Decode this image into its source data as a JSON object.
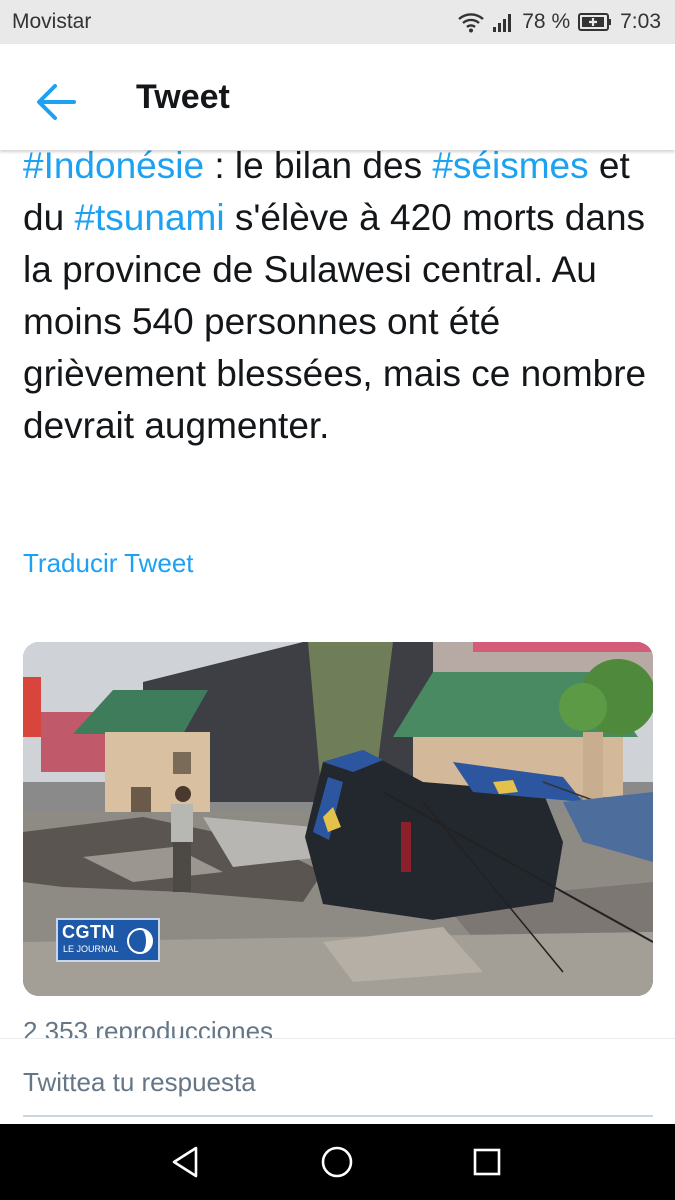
{
  "status_bar": {
    "carrier": "Movistar",
    "battery": "78 %",
    "time": "7:03"
  },
  "header": {
    "title": "Tweet"
  },
  "tweet": {
    "segments": [
      {
        "text": "#Indonésie",
        "hashtag": true
      },
      {
        "text": " : le bilan des ",
        "hashtag": false
      },
      {
        "text": "#séismes",
        "hashtag": true
      },
      {
        "text": " et du ",
        "hashtag": false
      },
      {
        "text": "#tsunami",
        "hashtag": true
      },
      {
        "text": " s'élève à 420 morts dans la province de Sulawesi central. Au moins 540 personnes ont été grièvement blessées, mais ce nombre devrait augmenter.",
        "hashtag": false
      }
    ],
    "translate_label": "Traducir Tweet",
    "media_caption": {
      "main": "CGTN",
      "sub": "LE JOURNAL"
    },
    "view_count": "2 353 reproducciones"
  },
  "reply": {
    "placeholder": "Twittea tu respuesta"
  },
  "colors": {
    "accent": "#1da1f2",
    "text": "#14171a",
    "muted": "#657786"
  },
  "icons": {
    "back": "arrow-left-icon",
    "wifi": "wifi-icon",
    "signal": "signal-icon",
    "battery": "battery-icon",
    "nav_back": "triangle-back-icon",
    "nav_home": "circle-home-icon",
    "nav_recents": "square-recents-icon"
  }
}
